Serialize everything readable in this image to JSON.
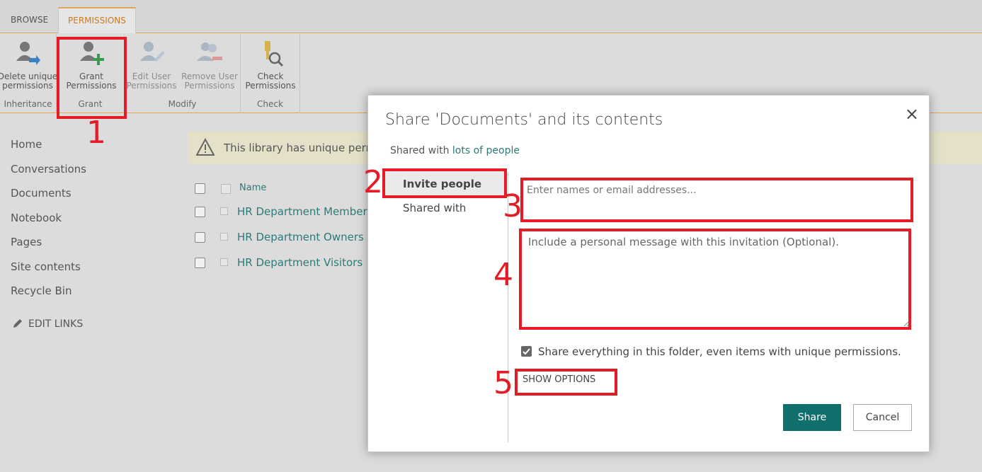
{
  "ribbon": {
    "tabs": [
      "BROWSE",
      "PERMISSIONS"
    ],
    "groups": [
      {
        "label": "Inheritance",
        "buttons": [
          {
            "label": "Delete unique permissions",
            "icon": "delete-inheritance-icon"
          }
        ]
      },
      {
        "label": "Grant",
        "buttons": [
          {
            "label": "Grant Permissions",
            "icon": "grant-permissions-icon"
          }
        ]
      },
      {
        "label": "Modify",
        "buttons": [
          {
            "label": "Edit User Permissions",
            "icon": "edit-user-icon"
          },
          {
            "label": "Remove User Permissions",
            "icon": "remove-user-icon"
          }
        ]
      },
      {
        "label": "Check",
        "buttons": [
          {
            "label": "Check Permissions",
            "icon": "check-permissions-icon"
          }
        ]
      }
    ],
    "b_delete_1": "Delete unique",
    "b_delete_2": "permissions",
    "b_grant_1": "Grant",
    "b_grant_2": "Permissions",
    "b_edit_1": "Edit User",
    "b_edit_2": "Permissions",
    "b_remove_1": "Remove User",
    "b_remove_2": "Permissions",
    "b_check_1": "Check",
    "b_check_2": "Permissions"
  },
  "nav": {
    "items": [
      "Home",
      "Conversations",
      "Documents",
      "Notebook",
      "Pages",
      "Site contents",
      "Recycle Bin"
    ],
    "edit_links": "EDIT LINKS"
  },
  "warning": {
    "text": "This library has unique perm"
  },
  "list": {
    "header": "Name",
    "rows": [
      "HR Department Members",
      "HR Department Owners",
      "HR Department Visitors"
    ]
  },
  "dialog": {
    "title": "Share 'Documents' and its contents",
    "shared_prefix": "Shared with",
    "shared_link": "lots of people",
    "tabs": [
      "Invite people",
      "Shared with"
    ],
    "names_placeholder": "Enter names or email addresses...",
    "message_placeholder": "Include a personal message with this invitation (Optional).",
    "share_all_label": "Share everything in this folder, even items with unique permissions.",
    "share_all_checked": true,
    "show_options": "SHOW OPTIONS",
    "share_button": "Share",
    "cancel_button": "Cancel",
    "close_glyph": "×"
  },
  "annotations": [
    "1",
    "2",
    "3",
    "4",
    "5"
  ],
  "colors": {
    "accent": "#106e6c",
    "link": "#2d7a78",
    "annotation": "#e31c25",
    "tab_accent": "#e0a55a"
  }
}
